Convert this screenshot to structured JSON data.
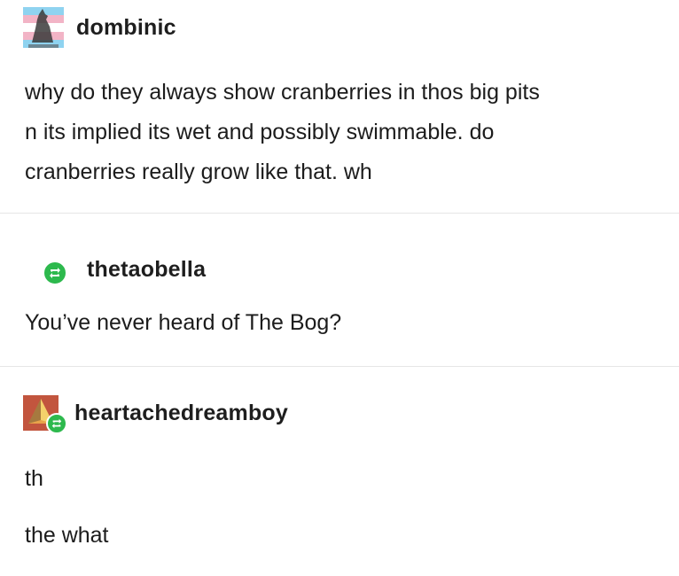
{
  "posts": [
    {
      "username": "dombinic",
      "avatar_icon": "trans-flag-avatar-icon",
      "body": "why do they always show cranberries in thos big pits\nn its implied its wet and possibly swimmable. do\ncranberries really grow like that. wh"
    },
    {
      "username": "thetaobella",
      "avatar_icon": "reblog-icon",
      "body": "You’ve never heard of The Bog?"
    },
    {
      "username": "heartachedreamboy",
      "avatar_icon": "pyramid-avatar-icon",
      "body_lines": [
        "th",
        "the what"
      ]
    }
  ],
  "colors": {
    "reblog_green": "#2db94d",
    "trans_blue": "#8fd3f0",
    "trans_pink": "#f2b4c6",
    "avatar3_bg": "#c2553e"
  }
}
